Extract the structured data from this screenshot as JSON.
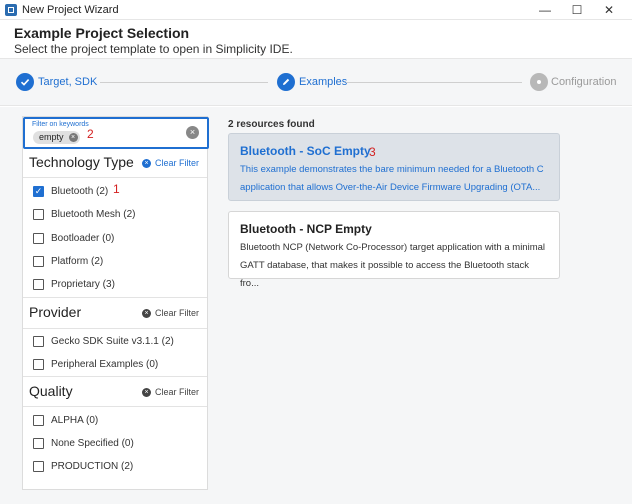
{
  "window": {
    "title": "New Project Wizard",
    "minimize": "—",
    "maximize": "☐",
    "close": "✕"
  },
  "header": {
    "title": "Example Project Selection",
    "subtitle": "Select the project template to open in Simplicity IDE."
  },
  "stepper": {
    "steps": [
      {
        "label": "Target, SDK",
        "state": "done",
        "icon": "check-icon"
      },
      {
        "label": "Examples",
        "state": "active",
        "icon": "pencil-icon"
      },
      {
        "label": "Configuration",
        "state": "inactive",
        "icon": "dot-icon"
      }
    ]
  },
  "filter": {
    "search": {
      "label": "Filter on keywords",
      "chip": "empty",
      "clear": "×"
    },
    "annotations": {
      "chip": "2",
      "bluetooth": "1",
      "card": "3"
    },
    "sections": [
      {
        "title": "Technology Type",
        "clear_label": "Clear Filter",
        "items": [
          {
            "label": "Bluetooth (2)",
            "checked": true
          },
          {
            "label": "Bluetooth Mesh (2)",
            "checked": false
          },
          {
            "label": "Bootloader (0)",
            "checked": false
          },
          {
            "label": "Platform (2)",
            "checked": false
          },
          {
            "label": "Proprietary (3)",
            "checked": false
          }
        ]
      },
      {
        "title": "Provider",
        "clear_label": "Clear Filter",
        "items": [
          {
            "label": "Gecko SDK Suite v3.1.1 (2)",
            "checked": false
          },
          {
            "label": "Peripheral Examples (0)",
            "checked": false
          }
        ]
      },
      {
        "title": "Quality",
        "clear_label": "Clear Filter",
        "items": [
          {
            "label": "ALPHA (0)",
            "checked": false
          },
          {
            "label": "None Specified (0)",
            "checked": false
          },
          {
            "label": "PRODUCTION (2)",
            "checked": false
          }
        ]
      }
    ]
  },
  "results": {
    "count_label": "2 resources found",
    "cards": [
      {
        "title": "Bluetooth - SoC Empty",
        "desc1": "This example demonstrates the bare minimum needed for a Bluetooth C",
        "desc2": "application that allows Over-the-Air Device Firmware Upgrading (OTA...",
        "selected": true
      },
      {
        "title": "Bluetooth - NCP Empty",
        "desc1": "Bluetooth NCP (Network Co-Processor) target application with a minimal",
        "desc2": "GATT database, that makes it possible to access the Bluetooth stack fro...",
        "selected": false
      }
    ]
  },
  "colors": {
    "accent": "#1f6fd1",
    "annotation": "#d32020",
    "selected_card": "#dde2e8"
  }
}
